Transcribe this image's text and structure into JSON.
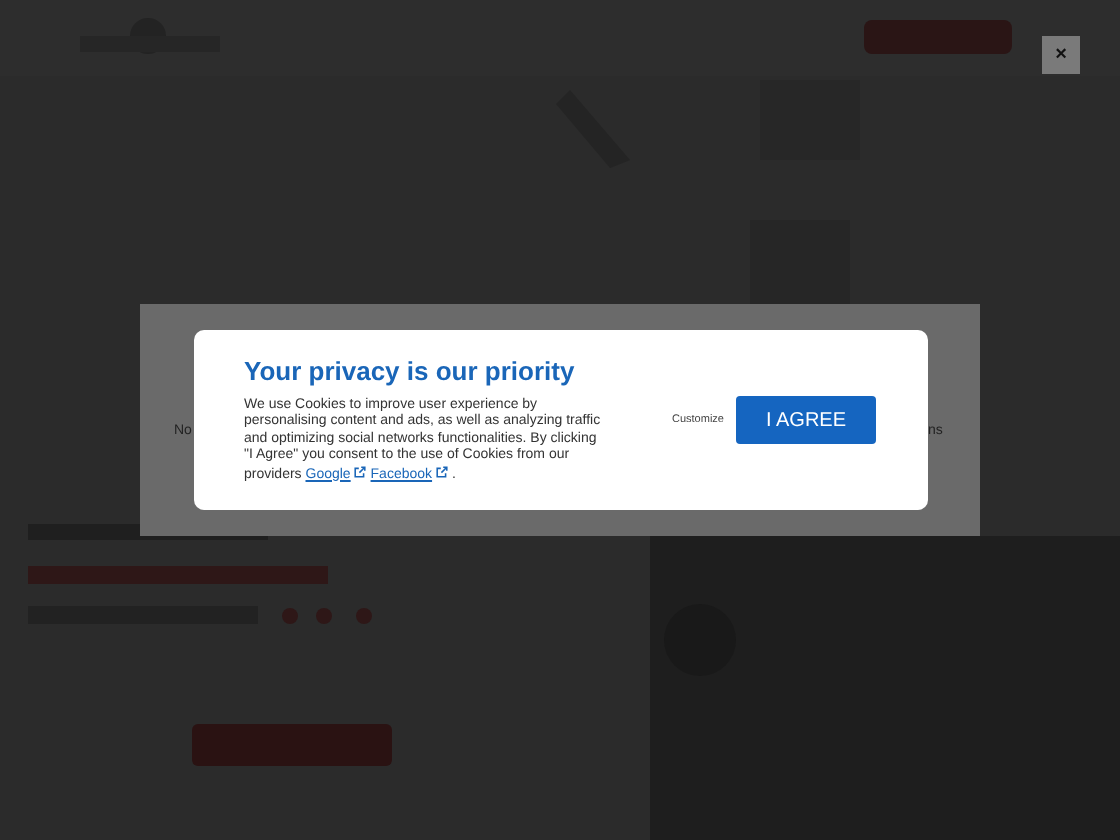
{
  "close_button": {
    "label": "×"
  },
  "band": {
    "left_text": "No",
    "right_text": "ns"
  },
  "consent": {
    "title": "Your privacy is our priority",
    "text": "We use Cookies to improve user experience by personalising content and ads, as well as analyzing traffic and optimizing social networks functionalities. By clicking \"I Agree\" you consent to the use of Cookies from our providers",
    "links": [
      "Google",
      "Facebook"
    ],
    "end": ".",
    "customize": "Customize",
    "agree": "I AGREE"
  }
}
